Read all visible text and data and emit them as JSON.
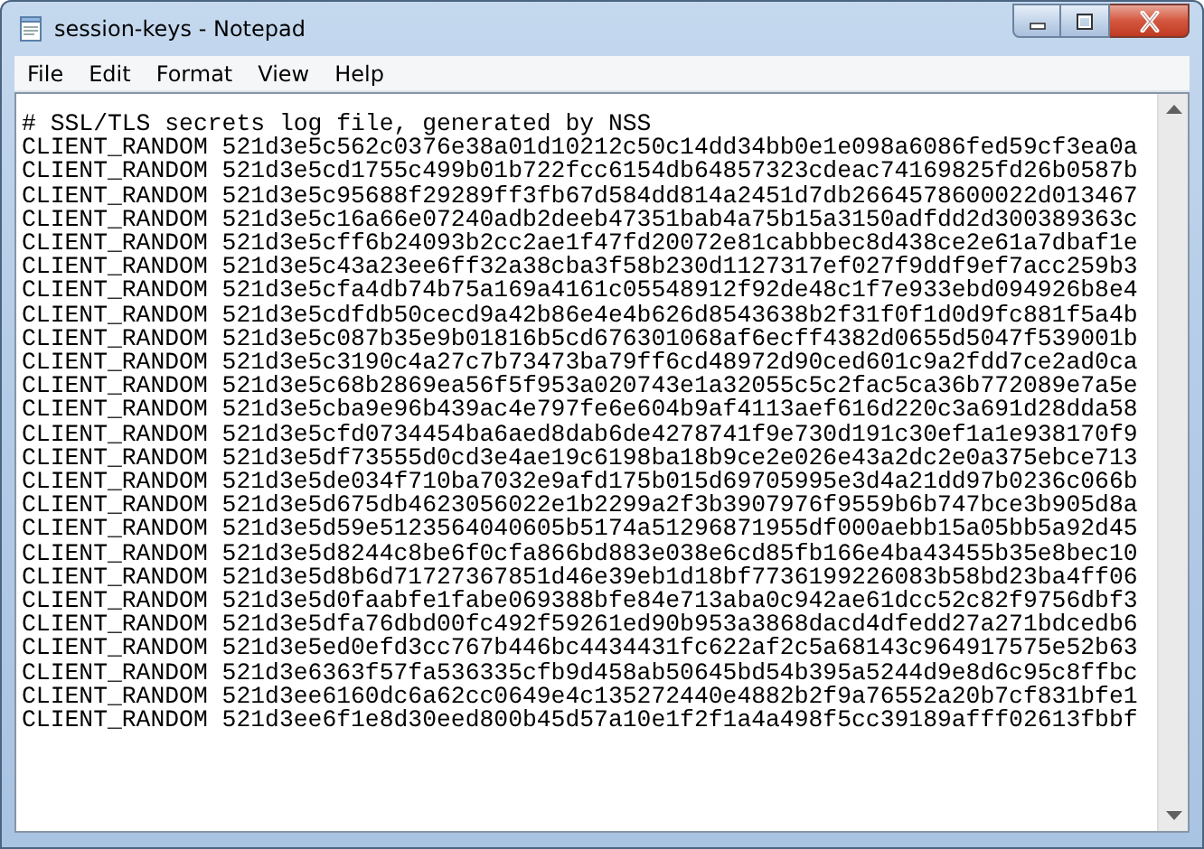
{
  "window": {
    "title": "session-keys - Notepad"
  },
  "menu": [
    "File",
    "Edit",
    "Format",
    "View",
    "Help"
  ],
  "editor": {
    "lines": [
      "# SSL/TLS secrets log file, generated by NSS",
      "CLIENT_RANDOM 521d3e5c562c0376e38a01d10212c50c14dd34bb0e1e098a6086fed59cf3ea0a",
      "CLIENT_RANDOM 521d3e5cd1755c499b01b722fcc6154db64857323cdeac74169825fd26b0587b",
      "CLIENT_RANDOM 521d3e5c95688f29289ff3fb67d584dd814a2451d7db2664578600022d013467",
      "CLIENT_RANDOM 521d3e5c16a66e07240adb2deeb47351bab4a75b15a3150adfdd2d300389363c",
      "CLIENT_RANDOM 521d3e5cff6b24093b2cc2ae1f47fd20072e81cabbbec8d438ce2e61a7dbaf1e",
      "CLIENT_RANDOM 521d3e5c43a23ee6ff32a38cba3f58b230d1127317ef027f9ddf9ef7acc259b3",
      "CLIENT_RANDOM 521d3e5cfa4db74b75a169a4161c05548912f92de48c1f7e933ebd094926b8e4",
      "CLIENT_RANDOM 521d3e5cdfdb50cecd9a42b86e4e4b626d8543638b2f31f0f1d0d9fc881f5a4b",
      "CLIENT_RANDOM 521d3e5c087b35e9b01816b5cd676301068af6ecff4382d0655d5047f539001b",
      "CLIENT_RANDOM 521d3e5c3190c4a27c7b73473ba79ff6cd48972d90ced601c9a2fdd7ce2ad0ca",
      "CLIENT_RANDOM 521d3e5c68b2869ea56f5f953a020743e1a32055c5c2fac5ca36b772089e7a5e",
      "CLIENT_RANDOM 521d3e5cba9e96b439ac4e797fe6e604b9af4113aef616d220c3a691d28dda58",
      "CLIENT_RANDOM 521d3e5cfd0734454ba6aed8dab6de4278741f9e730d191c30ef1a1e938170f9",
      "CLIENT_RANDOM 521d3e5df73555d0cd3e4ae19c6198ba18b9ce2e026e43a2dc2e0a375ebce713",
      "CLIENT_RANDOM 521d3e5de034f710ba7032e9afd175b015d69705995e3d4a21dd97b0236c066b",
      "CLIENT_RANDOM 521d3e5d675db4623056022e1b2299a2f3b3907976f9559b6b747bce3b905d8a",
      "CLIENT_RANDOM 521d3e5d59e5123564040605b5174a51296871955df000aebb15a05bb5a92d45",
      "CLIENT_RANDOM 521d3e5d8244c8be6f0cfa866bd883e038e6cd85fb166e4ba43455b35e8bec10",
      "CLIENT_RANDOM 521d3e5d8b6d71727367851d46e39eb1d18bf7736199226083b58bd23ba4ff06",
      "CLIENT_RANDOM 521d3e5d0faabfe1fabe069388bfe84e713aba0c942ae61dcc52c82f9756dbf3",
      "CLIENT_RANDOM 521d3e5dfa76dbd00fc492f59261ed90b953a3868dacd4dfedd27a271bdcedb6",
      "CLIENT_RANDOM 521d3e5ed0efd3cc767b446bc4434431fc622af2c5a68143c964917575e52b63",
      "CLIENT_RANDOM 521d3e6363f57fa536335cfb9d458ab50645bd54b395a5244d9e8d6c95c8ffbc",
      "CLIENT_RANDOM 521d3ee6160dc6a62cc0649e4c135272440e4882b2f9a76552a20b7cf831bfe1",
      "CLIENT_RANDOM 521d3ee6f1e8d30eed800b45d57a10e1f2f1a4a498f5cc39189afff02613fbbf"
    ]
  }
}
